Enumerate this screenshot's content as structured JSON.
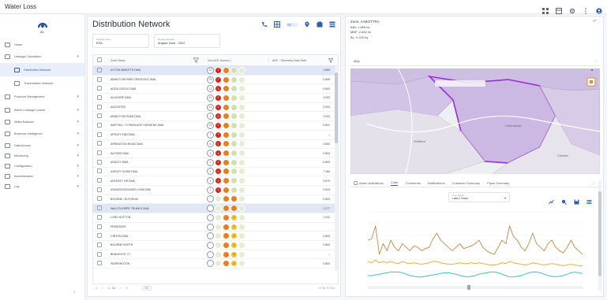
{
  "app": {
    "title": "Water Loss"
  },
  "topbar_icons": [
    "grid-icon",
    "layout-icon",
    "settings-icon",
    "more-icon",
    "user-icon"
  ],
  "logo": {
    "text": "WL"
  },
  "sidebar": {
    "items": [
      {
        "label": "Home",
        "icon": "home-icon"
      },
      {
        "label": "Leakage Calculation",
        "icon": "calculator-icon",
        "chevron": true
      },
      {
        "label": "Distribution Network",
        "icon": "network-icon",
        "active": true,
        "sub": true
      },
      {
        "label": "Transmission Network",
        "icon": "pipe-icon",
        "sub": true
      },
      {
        "label": "Pressure Management",
        "icon": "gauge-icon",
        "chevron": true
      },
      {
        "label": "Active Leakage Control",
        "icon": "leak-icon",
        "chevron": true
      },
      {
        "label": "Water Balance",
        "icon": "balance-icon",
        "chevron": true
      },
      {
        "label": "Business Intelligence",
        "icon": "bi-icon",
        "chevron": true
      },
      {
        "label": "Data Access",
        "icon": "database-icon",
        "chevron": true
      },
      {
        "label": "Monitoring",
        "icon": "monitor-icon",
        "chevron": true
      },
      {
        "label": "Configuration",
        "icon": "gear-icon",
        "chevron": true
      },
      {
        "label": "Administration",
        "icon": "admin-icon",
        "chevron": true
      },
      {
        "label": "Log",
        "icon": "log-icon",
        "chevron": true
      }
    ]
  },
  "main": {
    "title": "Distribution Network",
    "filters": [
      {
        "label": "Network name",
        "value": "ESA"
      },
      {
        "label": "Monthly Network",
        "value": "Anglian Zone - 2022"
      }
    ],
    "columns": {
      "name": "Zone Name",
      "alarms": "Non ACK Alarms (...",
      "adp": "ADP - Telemetry Data Start"
    },
    "rows": [
      {
        "name": "ACTON ABBOTTS DMA",
        "alarms": [
          [
            "empty",
            "22"
          ],
          [
            "red",
            "7"
          ],
          [
            "orange",
            ""
          ],
          [
            "pale",
            ""
          ],
          [
            "pale2",
            ""
          ]
        ],
        "adp": "1.890",
        "hl": true
      },
      {
        "name": "ABINGTON PARK CRESCENT DMA",
        "alarms": [
          [
            "empty",
            "23"
          ],
          [
            "red",
            "7"
          ],
          [
            "orange",
            ""
          ],
          [
            "pale",
            ""
          ],
          [
            "pale2",
            ""
          ]
        ],
        "adp": "0.805"
      },
      {
        "name": "AGDA CIRCLE DMA",
        "alarms": [
          [
            "empty",
            "11"
          ],
          [
            "red",
            "1"
          ],
          [
            "orange",
            ""
          ],
          [
            "pale",
            ""
          ],
          [
            "pale2",
            ""
          ]
        ],
        "adp": "0.603"
      },
      {
        "name": "ALDGORE DMA",
        "alarms": [
          [
            "empty",
            "10"
          ],
          [
            "red",
            "1"
          ],
          [
            "orange",
            ""
          ],
          [
            "pale",
            ""
          ],
          [
            "pale2",
            ""
          ]
        ],
        "adp": "2.003"
      },
      {
        "name": "ANCASTER",
        "alarms": [
          [
            "empty",
            "11"
          ],
          [
            "red",
            "1"
          ],
          [
            "orange",
            ""
          ],
          [
            "pale",
            ""
          ],
          [
            "pale2",
            ""
          ]
        ],
        "adp": "2.003"
      },
      {
        "name": "ABINGTON ROAD DMA",
        "alarms": [
          [
            "empty",
            "1"
          ],
          [
            "red",
            "3"
          ],
          [
            "orange",
            ""
          ],
          [
            "pale",
            ""
          ],
          [
            "pale2",
            ""
          ]
        ],
        "adp": "2.003"
      },
      {
        "name": "AMPTHILL TO REDGATE GARDENS DMA",
        "alarms": [
          [
            "empty",
            "23"
          ],
          [
            "red",
            "7"
          ],
          [
            "orange",
            ""
          ],
          [
            "pale",
            ""
          ],
          [
            "pale2",
            ""
          ]
        ],
        "adp": "0.821"
      },
      {
        "name": "APSLEY END DMA",
        "alarms": [
          [
            "empty",
            "7"
          ],
          [
            "red",
            "7"
          ],
          [
            "orange",
            ""
          ],
          [
            "pale",
            ""
          ],
          [
            "pale2",
            ""
          ]
        ],
        "adp": "–"
      },
      {
        "name": "ARRINGTON ROAD DMA",
        "alarms": [
          [
            "empty",
            "5"
          ],
          [
            "red",
            "1"
          ],
          [
            "orange",
            ""
          ],
          [
            "pale",
            ""
          ],
          [
            "pale2",
            ""
          ]
        ],
        "adp": "0.803"
      },
      {
        "name": "ALFORD DMA",
        "alarms": [
          [
            "empty",
            "3"
          ],
          [
            "red",
            "1"
          ],
          [
            "orange",
            ""
          ],
          [
            "pale",
            ""
          ],
          [
            "pale2",
            ""
          ]
        ],
        "adp": "0.803"
      },
      {
        "name": "ANSLEY DMA",
        "alarms": [
          [
            "empty",
            "1"
          ],
          [
            "red",
            "1"
          ],
          [
            "orange",
            ""
          ],
          [
            "pale",
            ""
          ],
          [
            "pale2",
            ""
          ]
        ],
        "adp": "0.803"
      },
      {
        "name": "ASPLEY GUISE DMA",
        "alarms": [
          [
            "empty",
            "1"
          ],
          [
            "red",
            "1"
          ],
          [
            "orange",
            ""
          ],
          [
            "pale",
            ""
          ],
          [
            "pale2",
            ""
          ]
        ],
        "adp": "7.184"
      },
      {
        "name": "ARLESEY HR DMA",
        "alarms": [
          [
            "empty",
            "1"
          ],
          [
            "red",
            "1"
          ],
          [
            "orange",
            ""
          ],
          [
            "pale",
            ""
          ],
          [
            "pale2",
            ""
          ]
        ],
        "adp": "3.970"
      },
      {
        "name": "ASHWOODS/VINES LYNN DMA",
        "alarms": [
          [
            "empty",
            "1"
          ],
          [
            "red",
            "1"
          ],
          [
            "orange",
            ""
          ],
          [
            "pale",
            ""
          ],
          [
            "pale2",
            ""
          ]
        ],
        "adp": "2.003"
      },
      {
        "name": "BOURNE / ELTHRUM",
        "alarms": [
          [
            "empty",
            ""
          ],
          [
            "pale2",
            ""
          ],
          [
            "orange",
            ""
          ],
          [
            "orange",
            ""
          ],
          [
            "pale2",
            ""
          ]
        ],
        "adp": "0.803"
      },
      {
        "name": "WALGTHORPE TRUNKS DMA",
        "alarms": [
          [
            "empty",
            ""
          ],
          [
            "pale2",
            ""
          ],
          [
            "orange",
            ""
          ],
          [
            "orange",
            ""
          ],
          [
            "pale2",
            ""
          ]
        ],
        "adp": "1.177",
        "hl": true
      },
      {
        "name": "LONG SUTTON",
        "alarms": [
          [
            "empty",
            ""
          ],
          [
            "pale2",
            ""
          ],
          [
            "orange",
            ""
          ],
          [
            "yellow",
            "2"
          ],
          [
            "pale2",
            ""
          ]
        ],
        "adp": "2.911"
      },
      {
        "name": "FRIGEDATE",
        "alarms": [
          [
            "empty",
            ""
          ],
          [
            "pale2",
            ""
          ],
          [
            "orange",
            ""
          ],
          [
            "yellow",
            "7"
          ],
          [
            "pale2",
            ""
          ]
        ],
        "adp": ""
      },
      {
        "name": "GIRTON DMA",
        "alarms": [
          [
            "empty",
            ""
          ],
          [
            "pale2",
            ""
          ],
          [
            "orange",
            ""
          ],
          [
            "yellow",
            "3"
          ],
          [
            "pale2",
            ""
          ]
        ],
        "adp": "0.803"
      },
      {
        "name": "BOURNE NORTH",
        "alarms": [
          [
            "empty",
            ""
          ],
          [
            "pale2",
            ""
          ],
          [
            "orange",
            ""
          ],
          [
            "yellow",
            "1"
          ],
          [
            "pale2",
            ""
          ]
        ],
        "adp": "0.803"
      },
      {
        "name": "BRANCOOT 72",
        "alarms": [
          [
            "empty",
            ""
          ],
          [
            "pale2",
            ""
          ],
          [
            "orange",
            ""
          ],
          [
            "yellow",
            "5"
          ],
          [
            "pale2",
            ""
          ]
        ],
        "adp": "–"
      },
      {
        "name": "WORKINGTON",
        "alarms": [
          [
            "empty",
            ""
          ],
          [
            "pale2",
            ""
          ],
          [
            "orange",
            ""
          ],
          [
            "yellow",
            "2"
          ],
          [
            "pale2",
            ""
          ]
        ],
        "adp": "0.803"
      }
    ],
    "pager": {
      "first": "«",
      "prev": "‹",
      "pages": "1 - 44",
      "next": "›",
      "last": "»",
      "per_page": "50",
      "right": "3736 TOTAL"
    }
  },
  "detail": {
    "zone_title": "Zone: AABOTTRA",
    "stats": [
      "INN: 1.890 l/s",
      "MNF: 2.842 l/s",
      "BL: 0.220 l/s"
    ],
    "map_tab": "Map",
    "tabs": [
      "Alarm Activations",
      "Chart",
      "Comments",
      "Notifications",
      "Customer Summary",
      "Pipes Summary"
    ],
    "active_tab": "Chart",
    "time_select": {
      "label": "Time Period",
      "value": "Last 2 Years"
    },
    "map_labels": [
      "Shelford",
      "Chelmsford",
      "Chester"
    ]
  },
  "colors": {
    "accent": "#2d5eb5",
    "map_fill": "#cfc0e3",
    "map_border": "#9c2bd9",
    "flow_orange": "#c8782a",
    "flow_yellow": "#e0b23a",
    "flow_teal": "#3cc5c9"
  },
  "chart_data": {
    "type": "line",
    "series": [
      {
        "color": "#c8782a",
        "values": [
          0.6,
          0.62,
          0.8,
          0.4,
          0.55,
          0.45,
          0.6,
          0.5,
          0.45,
          0.55,
          0.5,
          0.45,
          0.52,
          0.5,
          0.45,
          0.48,
          0.5,
          0.62,
          0.7,
          0.6,
          0.55,
          0.5,
          0.45,
          0.5,
          0.55,
          0.48,
          0.5,
          0.52,
          0.55,
          0.6,
          0.5,
          0.45,
          0.42,
          0.4,
          0.5,
          0.6,
          0.55,
          0.8,
          0.65,
          0.6,
          0.5,
          0.45,
          0.55,
          0.7,
          0.55,
          0.5,
          0.45,
          0.55,
          0.6,
          0.5,
          0.45,
          0.42,
          0.5,
          0.6,
          0.5,
          0.45,
          0.4
        ]
      },
      {
        "color": "#e0b23a",
        "values": [
          0.3,
          0.28,
          0.32,
          0.28,
          0.3,
          0.28,
          0.3,
          0.28,
          0.27,
          0.3,
          0.28,
          0.27,
          0.28,
          0.27,
          0.26,
          0.27,
          0.28,
          0.3,
          0.3,
          0.28,
          0.27,
          0.26,
          0.26,
          0.27,
          0.28,
          0.27,
          0.27,
          0.28,
          0.27,
          0.28,
          0.27,
          0.26,
          0.25,
          0.25,
          0.26,
          0.28,
          0.27,
          0.3,
          0.28,
          0.27,
          0.26,
          0.25,
          0.26,
          0.28,
          0.27,
          0.26,
          0.25,
          0.26,
          0.27,
          0.26,
          0.25,
          0.24,
          0.25,
          0.26,
          0.25,
          0.24,
          0.24
        ]
      },
      {
        "color": "#3cc5c9",
        "values": [
          0.1,
          0.1,
          0.11,
          0.12,
          0.13,
          0.14,
          0.15,
          0.15,
          0.15,
          0.14,
          0.12,
          0.1,
          0.09,
          0.08,
          0.08,
          0.09,
          0.1,
          0.11,
          0.12,
          0.13,
          0.14,
          0.14,
          0.13,
          0.12,
          0.1,
          0.09,
          0.08,
          0.09,
          0.1,
          0.12,
          0.13,
          0.14,
          0.15,
          0.15,
          0.14,
          0.12,
          0.1,
          0.08,
          0.08,
          0.09,
          0.1,
          0.12,
          0.14,
          0.15,
          0.15,
          0.14,
          0.12,
          0.1,
          0.09,
          0.08,
          0.09,
          0.1,
          0.12,
          0.14,
          0.15,
          0.14,
          0.13
        ]
      }
    ]
  }
}
